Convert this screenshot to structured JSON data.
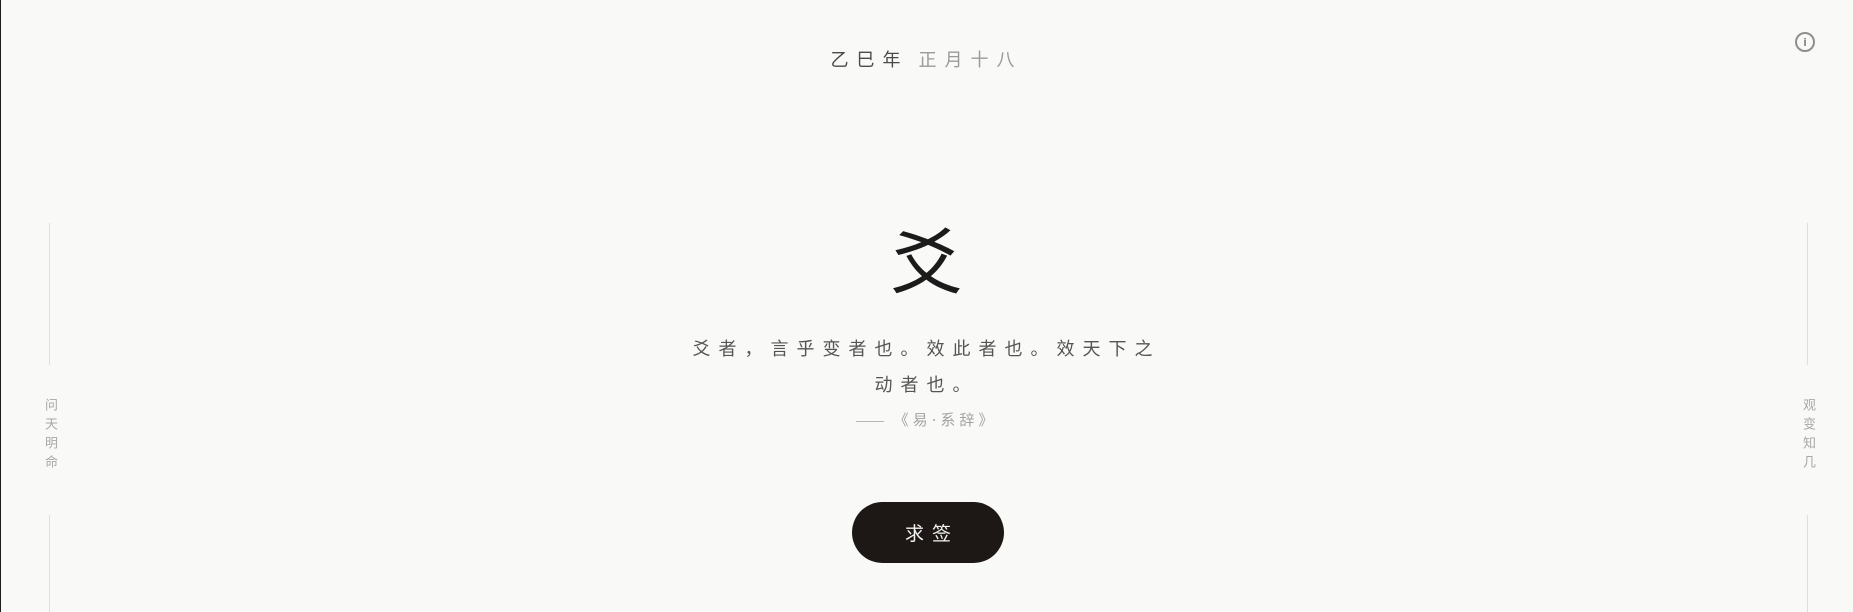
{
  "header": {
    "year": "乙巳年",
    "day": "正月十八",
    "info_icon": "info-icon"
  },
  "sidebar_left": {
    "text": "问天明命"
  },
  "sidebar_right": {
    "text": "观变知几"
  },
  "main": {
    "glyph": "爻",
    "quote": "爻者，言乎变者也。效此者也。效天下之动者也。",
    "source": "《易·系辞》"
  },
  "action": {
    "button_label": "求签"
  },
  "colors": {
    "background": "#f9f9f7",
    "button": "#1d1815",
    "text": "#2a2a2a"
  }
}
